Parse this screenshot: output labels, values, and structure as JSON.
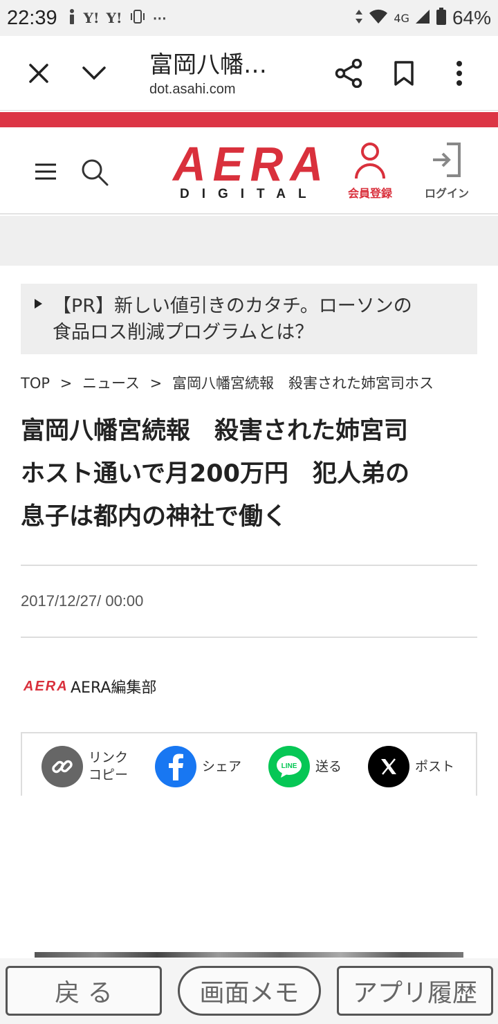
{
  "status_bar": {
    "time": "22:39",
    "left_icons": [
      "Y!",
      "Y!"
    ],
    "network": "4G",
    "battery": "64%"
  },
  "browser": {
    "title": "富岡八幡…",
    "url": "dot.asahi.com",
    "icons": [
      "close-icon",
      "chevron-down-icon",
      "share-icon",
      "bookmark-icon",
      "more-vertical-icon"
    ]
  },
  "site_header": {
    "logo_main": "AERA",
    "logo_sub": "DIGITAL",
    "register_label": "会員登録",
    "login_label": "ログイン",
    "accent_color": "#d9303c"
  },
  "pr_banner": {
    "line1": "【PR】新しい値引きのカタチ。ローソンの",
    "line2": "食品ロス削減プログラムとは？"
  },
  "breadcrumb": {
    "items": [
      "TOP",
      ">",
      "ニュース",
      ">",
      "富岡八幡宮続報　殺害された姉宮司ホス"
    ]
  },
  "article": {
    "headline_lines": [
      "富岡八幡宮続報　殺害された姉宮司",
      "ホスト通いで月200万円　犯人弟の",
      "息子は都内の神社で働く"
    ],
    "date": "2017/12/27/ 00:00",
    "author_logo": "AERA",
    "author": "AERA編集部"
  },
  "share": {
    "link_copy_line1": "リンク",
    "link_copy_line2": "コピー",
    "facebook_label": "シェア",
    "line_label": "送る",
    "line_badge": "LINE",
    "x_label": "ポスト",
    "facebook_color": "#1877f2",
    "line_color": "#06c755"
  },
  "bottom_nav": {
    "back": "戻 る",
    "memo": "画面メモ",
    "history": "アプリ履歴"
  }
}
